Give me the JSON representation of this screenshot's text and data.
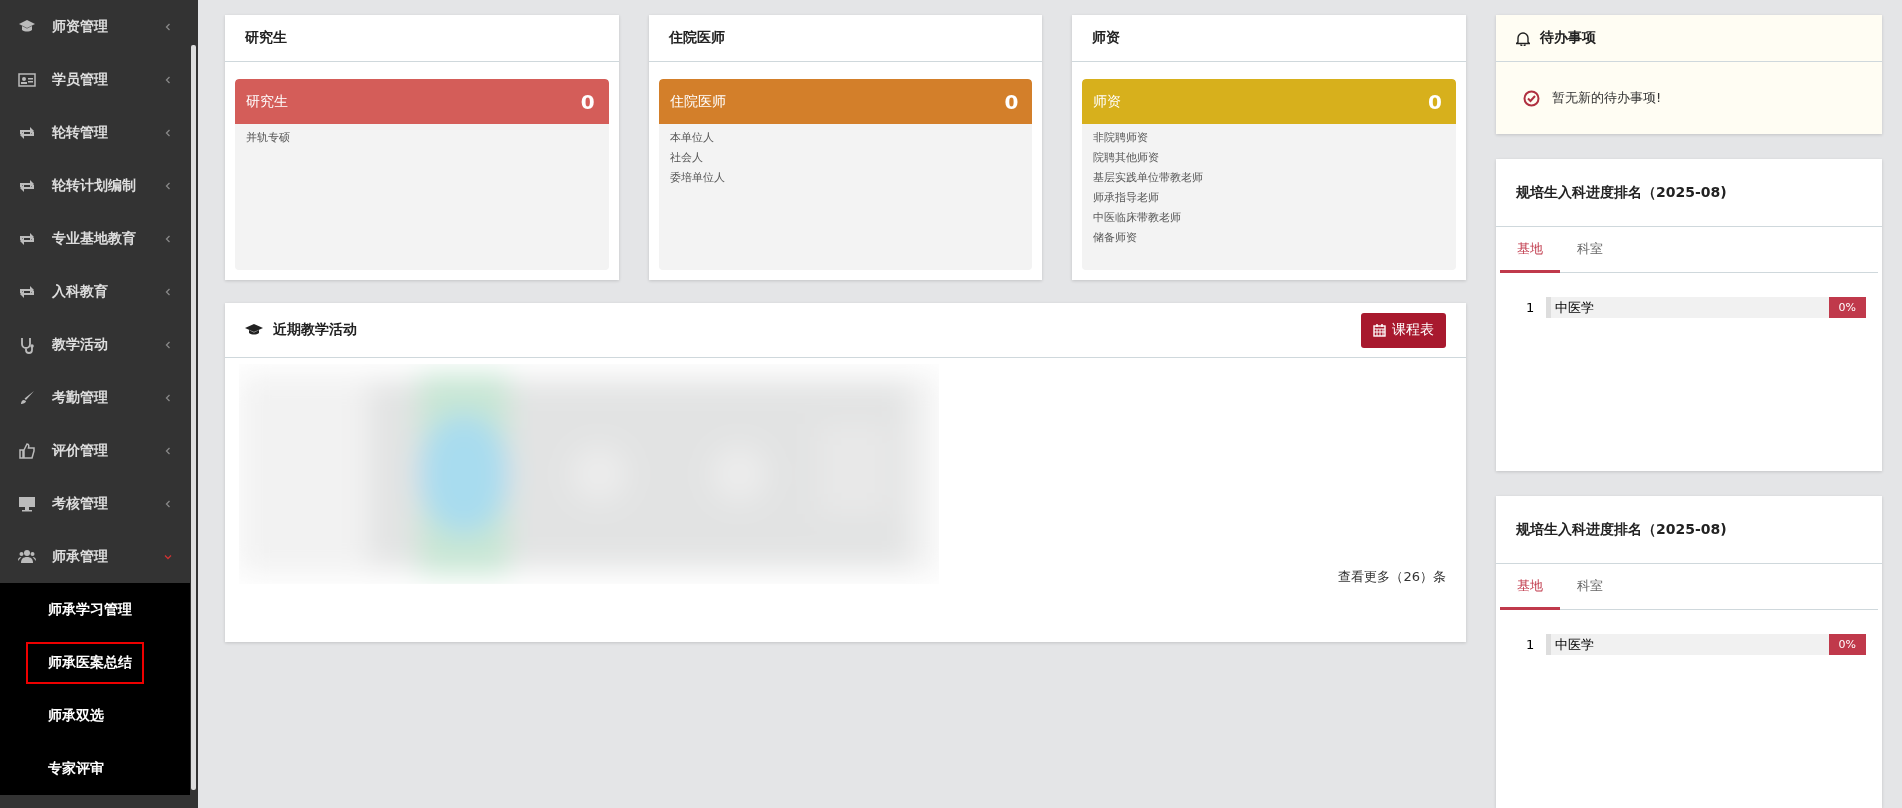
{
  "sidebar": {
    "items": [
      {
        "label": "师资管理",
        "expanded": false
      },
      {
        "label": "学员管理",
        "expanded": false
      },
      {
        "label": "轮转管理",
        "expanded": false
      },
      {
        "label": "轮转计划编制",
        "expanded": false
      },
      {
        "label": "专业基地教育",
        "expanded": false
      },
      {
        "label": "入科教育",
        "expanded": false
      },
      {
        "label": "教学活动",
        "expanded": false
      },
      {
        "label": "考勤管理",
        "expanded": false
      },
      {
        "label": "评价管理",
        "expanded": false
      },
      {
        "label": "考核管理",
        "expanded": false
      },
      {
        "label": "师承管理",
        "expanded": true,
        "children": [
          {
            "label": "师承学习管理",
            "selected": false
          },
          {
            "label": "师承医案总结",
            "selected": true
          },
          {
            "label": "师承双选",
            "selected": false
          },
          {
            "label": "专家评审",
            "selected": false
          }
        ]
      }
    ]
  },
  "stat_cards": [
    {
      "title": "研究生",
      "label": "研究生",
      "count": "0",
      "color": "#d45d59",
      "lines": [
        "并轨专硕"
      ]
    },
    {
      "title": "住院医师",
      "label": "住院医师",
      "count": "0",
      "color": "#d37f2a",
      "lines": [
        "本单位人",
        "社会人",
        "委培单位人"
      ]
    },
    {
      "title": "师资",
      "label": "师资",
      "count": "0",
      "color": "#d7b01c",
      "lines": [
        "非院聘师资",
        "院聘其他师资",
        "基层实践单位带教老师",
        "师承指导老师",
        "中医临床带教老师",
        "储备师资"
      ]
    }
  ],
  "activities": {
    "title": "近期教学活动",
    "button": "课程表",
    "more": "查看更多（26）条",
    "kind": "picture"
  },
  "todo": {
    "title": "待办事项",
    "message": "暂无新的待办事项!"
  },
  "rankings": [
    {
      "title": "规培生入科进度排名（2025-08)",
      "tabs": [
        {
          "label": "基地",
          "selected": true
        },
        {
          "label": "科室",
          "selected": false
        }
      ],
      "rows": [
        {
          "rank": "1",
          "name": "中医学",
          "percent": "0%"
        }
      ]
    },
    {
      "title": "规培生入科进度排名（2025-08)",
      "tabs": [
        {
          "label": "基地",
          "selected": true
        },
        {
          "label": "科室",
          "selected": false
        }
      ],
      "rows": [
        {
          "rank": "1",
          "name": "中医学",
          "percent": "0%"
        }
      ]
    }
  ]
}
